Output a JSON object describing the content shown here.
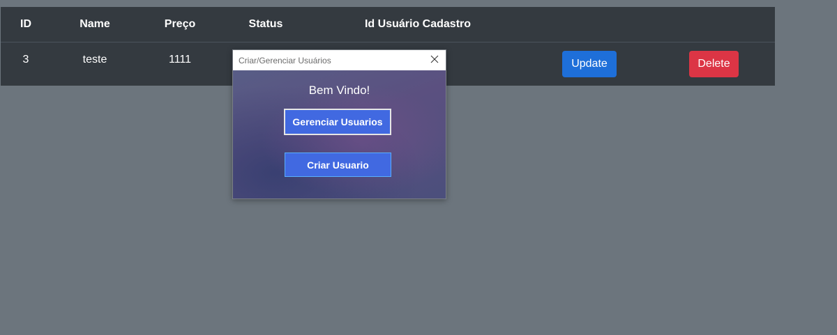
{
  "table": {
    "headers": {
      "id": "ID",
      "name": "Name",
      "price": "Preço",
      "status": "Status",
      "user_id": "Id Usuário Cadastro"
    },
    "rows": [
      {
        "id": "3",
        "name": "teste",
        "price": "1111",
        "status": "",
        "user_id": ""
      }
    ],
    "update_label": "Update",
    "delete_label": "Delete"
  },
  "dialog": {
    "title": "Criar/Gerenciar Usuários",
    "welcome": "Bem Vindo!",
    "manage_label": "Gerenciar Usuarios",
    "create_label": "Criar Usuario"
  },
  "colors": {
    "page_background": "#6c757d",
    "table_background": "#343a40",
    "update_button": "#1e6fd9",
    "delete_button": "#dc3545",
    "dialog_button": "#4169e1"
  },
  "icons": {
    "close": "close-icon"
  }
}
